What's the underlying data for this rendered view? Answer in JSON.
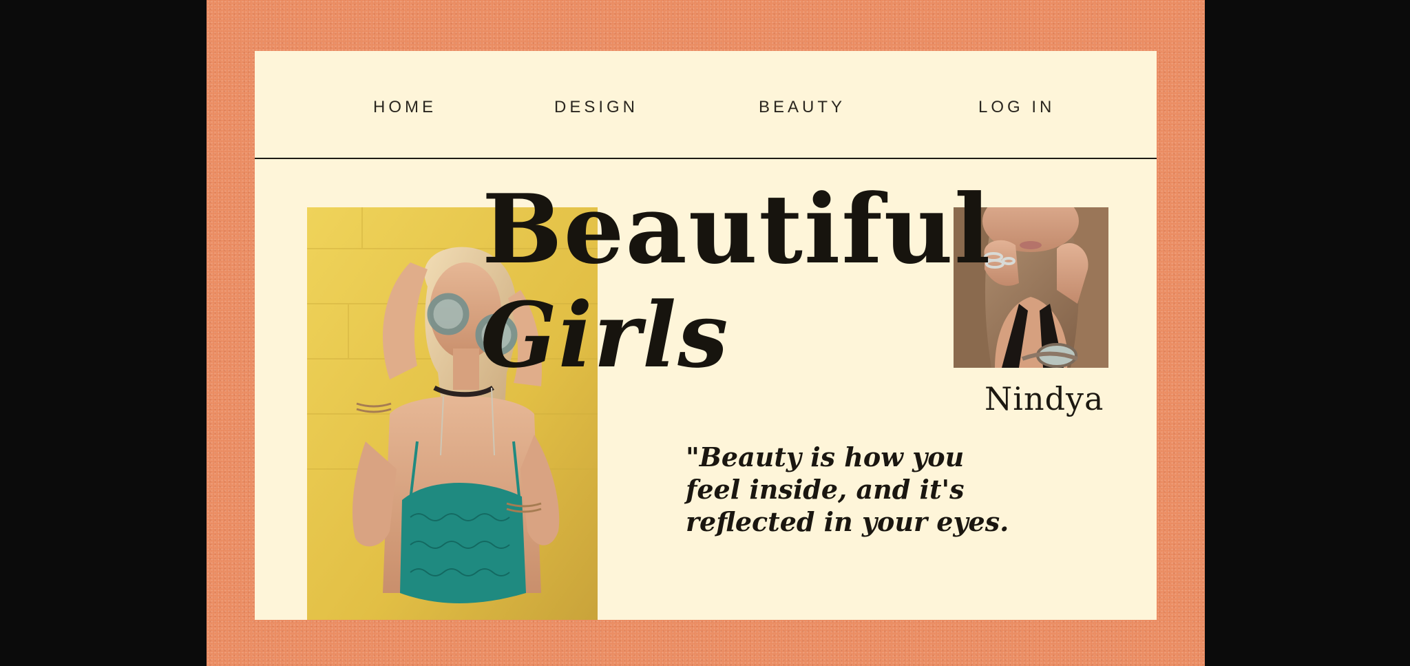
{
  "nav": {
    "items": [
      {
        "label": "HOME"
      },
      {
        "label": "DESIGN"
      },
      {
        "label": "BEAUTY"
      },
      {
        "label": "LOG IN"
      }
    ]
  },
  "hero": {
    "title_line1": "Beautiful",
    "title_line2": "Girls"
  },
  "feature": {
    "name": "Nindya"
  },
  "quote": {
    "lines": [
      "\"Beauty is how you",
      "feel inside, and it's",
      "reflected in your eyes."
    ]
  },
  "colors": {
    "frame": "#e9895f",
    "card": "#fef5d9",
    "ink": "#17140e",
    "backdrop": "#0b0b0b",
    "photo_wall": "#e9c64a",
    "top_teal": "#1f8a80"
  }
}
